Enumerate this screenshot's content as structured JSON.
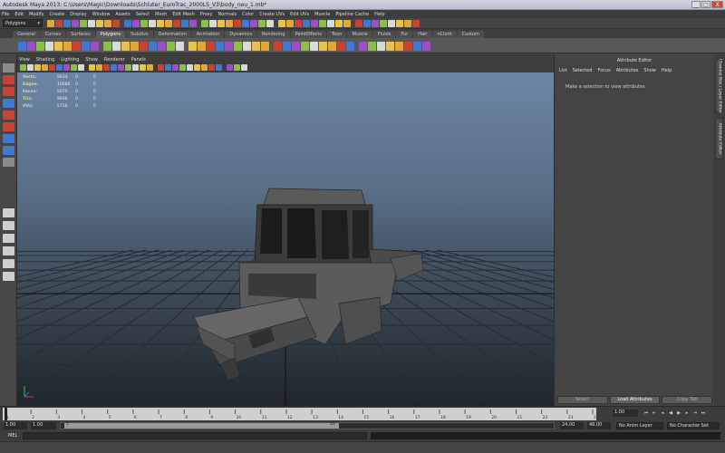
{
  "window": {
    "title": "Autodesk Maya 2013: C:\\Users\\Magic\\Downloads\\Schluter_EuroTrac_2000LS_V3\\body_neu_1.mb*",
    "minimize": "_",
    "maximize": "□",
    "close": "X"
  },
  "menubar": [
    "File",
    "Edit",
    "Modify",
    "Create",
    "Display",
    "Window",
    "Assets",
    "Select",
    "Mesh",
    "Edit Mesh",
    "Proxy",
    "Normals",
    "Color",
    "Create UVs",
    "Edit UVs",
    "Muscle",
    "Pipeline Cache",
    "Help"
  ],
  "statusline": {
    "mode": "Polygons"
  },
  "shelf_tabs": [
    {
      "label": "General",
      "active": false
    },
    {
      "label": "Curves",
      "active": false
    },
    {
      "label": "Surfaces",
      "active": false
    },
    {
      "label": "Polygons",
      "active": true
    },
    {
      "label": "Subdivs",
      "active": false
    },
    {
      "label": "Deformation",
      "active": false
    },
    {
      "label": "Animation",
      "active": false
    },
    {
      "label": "Dynamics",
      "active": false
    },
    {
      "label": "Rendering",
      "active": false
    },
    {
      "label": "PaintEffects",
      "active": false
    },
    {
      "label": "Toon",
      "active": false
    },
    {
      "label": "Muscle",
      "active": false
    },
    {
      "label": "Fluids",
      "active": false
    },
    {
      "label": "Fur",
      "active": false
    },
    {
      "label": "Hair",
      "active": false
    },
    {
      "label": "nCloth",
      "active": false
    },
    {
      "label": "Custom",
      "active": false
    }
  ],
  "viewport_menu": [
    "View",
    "Shading",
    "Lighting",
    "Show",
    "Renderer",
    "Panels"
  ],
  "hud": [
    {
      "label": "Verts:",
      "v1": "5634",
      "v2": "0",
      "v3": "0"
    },
    {
      "label": "Edges:",
      "v1": "10686",
      "v2": "0",
      "v3": "0"
    },
    {
      "label": "Faces:",
      "v1": "5070",
      "v2": "0",
      "v3": "0"
    },
    {
      "label": "Tris:",
      "v1": "9938",
      "v2": "0",
      "v3": "0"
    },
    {
      "label": "UVs:",
      "v1": "5738",
      "v2": "0",
      "v3": "0"
    }
  ],
  "attribute_editor": {
    "title": "Attribute Editor",
    "menu": [
      "List",
      "Selected",
      "Focus",
      "Attributes",
      "Show",
      "Help"
    ],
    "message": "Make a selection to view attributes",
    "buttons": {
      "select": "Select",
      "load": "Load Attributes",
      "copy": "Copy Tab"
    }
  },
  "side_tabs": [
    "Channel Box / Layer Editor",
    "Attribute Editor"
  ],
  "time_slider": {
    "ticks": [
      "1",
      "2",
      "3",
      "4",
      "5",
      "6",
      "7",
      "8",
      "9",
      "10",
      "11",
      "12",
      "13",
      "14",
      "15",
      "16",
      "17",
      "18",
      "19",
      "20",
      "21",
      "22",
      "23",
      "24"
    ],
    "current_frame": "1.00"
  },
  "range_slider": {
    "start": "1.00",
    "playback_start": "1.00",
    "handle_start": "1",
    "handle_end": "24",
    "playback_end": "24.00",
    "end": "48.00",
    "anim_layer": "No Anim Layer",
    "character_set": "No Character Set"
  },
  "command_line": {
    "label": "MEL"
  },
  "colors": {
    "shelf_icon_yellow": "#e0a83a",
    "shelf_icon_purple": "#9b4fc3",
    "tool_red": "#c84235",
    "tool_blue": "#3e7ad0",
    "axis_x": "#d04040",
    "axis_y": "#40c040",
    "axis_z": "#4070d0"
  }
}
